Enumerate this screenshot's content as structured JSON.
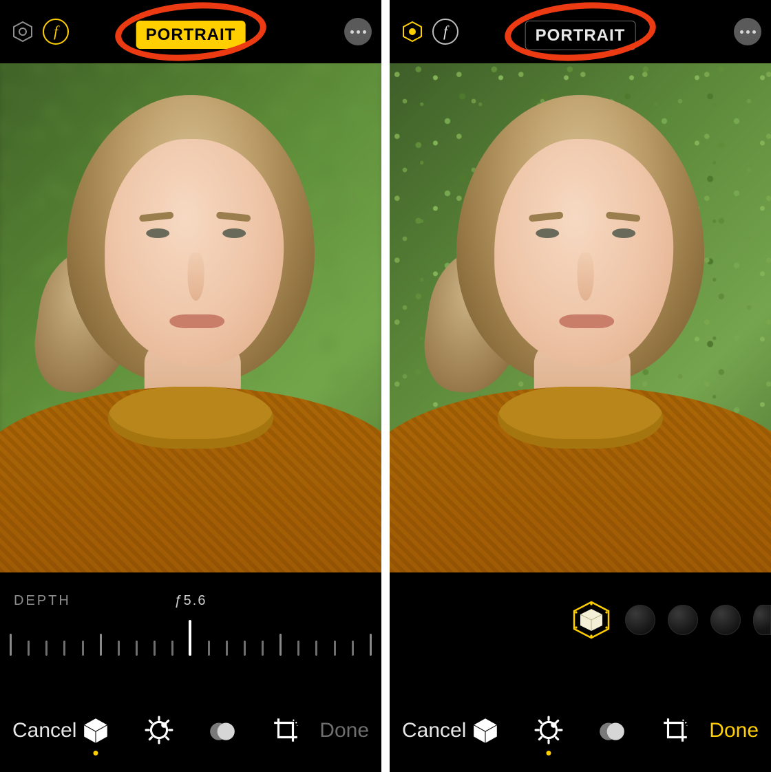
{
  "colors": {
    "accent": "#ffcf00",
    "annotation": "#ec3b13"
  },
  "left": {
    "topbar": {
      "hex_active": false,
      "f_active": true,
      "mode_label": "PORTRAIT",
      "mode_active": true
    },
    "mid": {
      "type": "depth",
      "label": "DEPTH",
      "value": "ƒ5.6"
    },
    "toolbar": {
      "cancel": "Cancel",
      "done": "Done",
      "done_enabled": false,
      "active_index": 0
    }
  },
  "right": {
    "topbar": {
      "hex_active": true,
      "f_active": false,
      "mode_label": "PORTRAIT",
      "mode_active": false
    },
    "mid": {
      "type": "lighting",
      "selected_index": 0,
      "option_count": 4
    },
    "toolbar": {
      "cancel": "Cancel",
      "done": "Done",
      "done_enabled": true,
      "active_index": 1
    }
  },
  "tool_icons": [
    "portrait-cube-icon",
    "adjust-dial-icon",
    "filters-icon",
    "crop-rotate-icon"
  ]
}
